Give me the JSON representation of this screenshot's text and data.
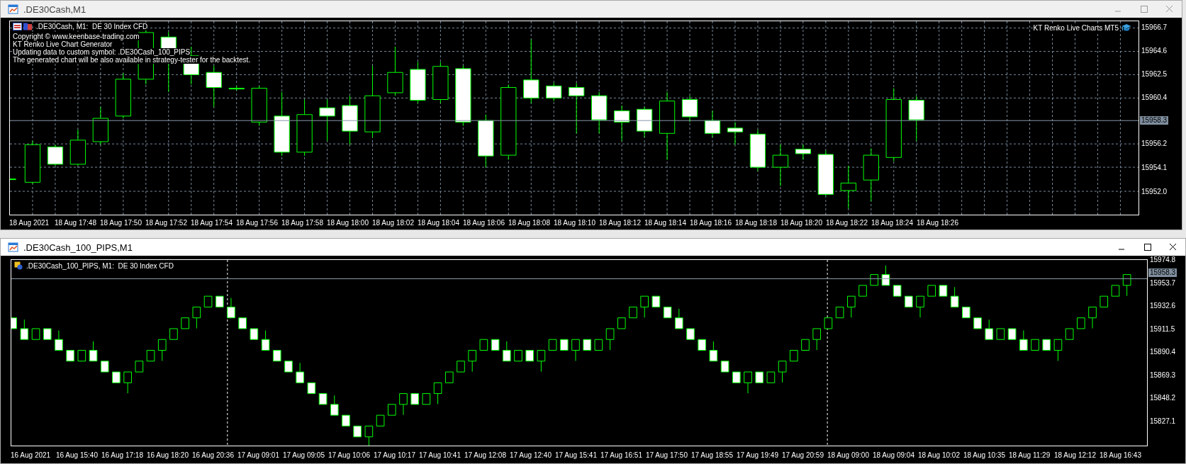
{
  "windows": [
    {
      "title": ".DE30Cash,M1",
      "active": false,
      "chart": {
        "kind": "candles",
        "symbol_line": ".DE30Cash, M1:  DE 30 Index CFD",
        "info_lines": [
          "Copyright © www.keenbase-trading.com",
          "KT Renko Live Chart Generator",
          "Updating data to custom symbol: .DE30Cash_100_PIPS",
          "The generated chart will be also available in strategy-tester for the backtest."
        ],
        "brand_label": "KT Renko Live Charts MT5",
        "price_labels": [
          "15966.7",
          "15964.6",
          "15962.5",
          "15960.4",
          "15956.2",
          "15954.1",
          "15952.0"
        ],
        "current_price": "15958.3",
        "time_labels": [
          "18 Aug 2021",
          "18 Aug 17:48",
          "18 Aug 17:50",
          "18 Aug 17:52",
          "18 Aug 17:54",
          "18 Aug 17:56",
          "18 Aug 17:58",
          "18 Aug 18:00",
          "18 Aug 18:02",
          "18 Aug 18:04",
          "18 Aug 18:06",
          "18 Aug 18:08",
          "18 Aug 18:10",
          "18 Aug 18:12",
          "18 Aug 18:14",
          "18 Aug 18:16",
          "18 Aug 18:18",
          "18 Aug 18:20",
          "18 Aug 18:22",
          "18 Aug 18:24",
          "18 Aug 18:26"
        ]
      }
    },
    {
      "title": ".DE30Cash_100_PIPS,M1",
      "active": true,
      "chart": {
        "kind": "renko",
        "symbol_line": ".DE30Cash_100_PIPS, M1:  DE 30 Index CFD",
        "price_labels": [
          "15974.8",
          "15953.7",
          "15932.6",
          "15911.5",
          "15890.4",
          "15869.3",
          "15848.2",
          "15827.1"
        ],
        "current_price": "15958.3",
        "time_labels": [
          "16 Aug 2021",
          "16 Aug 15:40",
          "16 Aug 17:18",
          "16 Aug 18:20",
          "16 Aug 20:36",
          "17 Aug 09:01",
          "17 Aug 09:05",
          "17 Aug 10:06",
          "17 Aug 10:17",
          "17 Aug 10:41",
          "17 Aug 12:08",
          "17 Aug 12:40",
          "17 Aug 15:41",
          "17 Aug 16:51",
          "17 Aug 17:50",
          "17 Aug 18:55",
          "17 Aug 19:49",
          "17 Aug 20:59",
          "18 Aug 09:00",
          "18 Aug 09:04",
          "18 Aug 10:02",
          "18 Aug 10:35",
          "18 Aug 11:29",
          "18 Aug 12:12",
          "18 Aug 16:43"
        ]
      }
    }
  ]
}
